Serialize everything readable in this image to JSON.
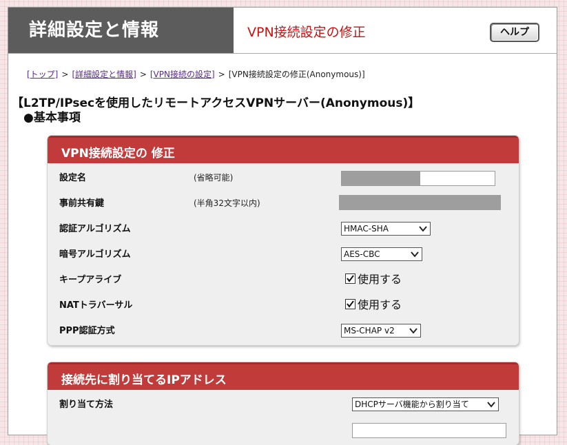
{
  "header": {
    "title": "詳細設定と情報",
    "subtitle": "VPN接続設定の修正",
    "help_label": "ヘルプ"
  },
  "breadcrumb": {
    "items": [
      "[トップ]",
      "[詳細設定と情報]",
      "[VPN接続の設定]"
    ],
    "separator": ">",
    "current": "[VPN接続設定の修正(Anonymous)]"
  },
  "page_title": "【L2TP/IPsecを使用したリモートアクセスVPNサーバー(Anonymous)】",
  "section_title": "●基本事項",
  "panel1": {
    "heading": "VPN接続設定の 修正",
    "rows": [
      {
        "label": "設定名",
        "note": "(省略可能)",
        "value": ""
      },
      {
        "label": "事前共有鍵",
        "note": "(半角32文字以内)",
        "value": ""
      },
      {
        "label": "認証アルゴリズム",
        "value": "HMAC-SHA"
      },
      {
        "label": "暗号アルゴリズム",
        "value": "AES-CBC"
      },
      {
        "label": "キープアライブ",
        "value": "使用する",
        "checked": true
      },
      {
        "label": "NATトラバーサル",
        "value": "使用する",
        "checked": true
      },
      {
        "label": "PPP認証方式",
        "value": "MS-CHAP v2"
      }
    ]
  },
  "panel2": {
    "heading": "接続先に割り当てるIPアドレス",
    "rows": [
      {
        "label": "割り当て方法",
        "value": "DHCPサーバ機能から割り当て"
      }
    ]
  },
  "colors": {
    "accent": "#c23b3b",
    "header_bg": "#5c5c5c",
    "subtitle": "#cc1111",
    "masked": "#9e9e9e"
  }
}
